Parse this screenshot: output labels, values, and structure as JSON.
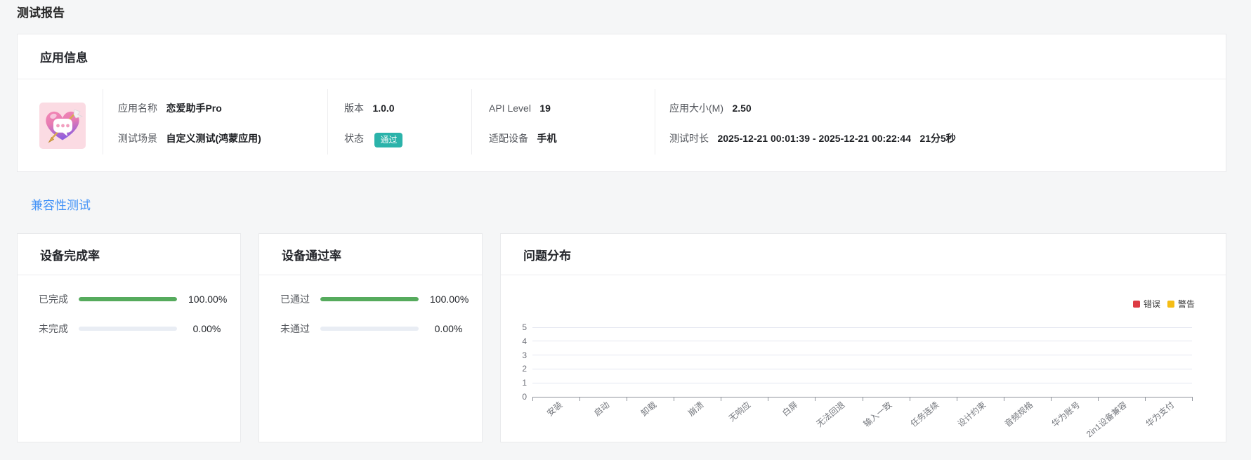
{
  "page": {
    "title": "测试报告",
    "background": "#f5f6f7"
  },
  "app_info": {
    "title": "应用信息",
    "icon": "heart-chat-arrow-app-icon",
    "fields": {
      "app_name": {
        "label": "应用名称",
        "value": "恋爱助手Pro"
      },
      "test_scene": {
        "label": "测试场景",
        "value": "自定义测试(鸿蒙应用)"
      },
      "version": {
        "label": "版本",
        "value": "1.0.0"
      },
      "status": {
        "label": "状态",
        "value": "通过",
        "badge_color": "#2bb3aa"
      },
      "api_level": {
        "label": "API Level",
        "value": "19"
      },
      "device": {
        "label": "适配设备",
        "value": "手机"
      },
      "app_size": {
        "label": "应用大小(M)",
        "value": "2.50"
      },
      "duration": {
        "label": "测试时长",
        "value": "2025-12-21 00:01:39 - 2025-12-21 00:22:44",
        "elapsed": "21分5秒"
      }
    }
  },
  "section_link": {
    "label": "兼容性测试",
    "color": "#4292f7"
  },
  "completion_card": {
    "title": "设备完成率",
    "rows": [
      {
        "label": "已完成",
        "value": "100.00%",
        "percent": 100,
        "color": "#56ab5d"
      },
      {
        "label": "未完成",
        "value": "0.00%",
        "percent": 0,
        "color": "#56ab5d"
      }
    ]
  },
  "pass_card": {
    "title": "设备通过率",
    "rows": [
      {
        "label": "已通过",
        "value": "100.00%",
        "percent": 100,
        "color": "#56ab5d"
      },
      {
        "label": "未通过",
        "value": "0.00%",
        "percent": 0,
        "color": "#56ab5d"
      }
    ]
  },
  "issue_card": {
    "title": "问题分布"
  },
  "chart_data": {
    "type": "bar",
    "title": "问题分布",
    "categories": [
      "安装",
      "启动",
      "卸载",
      "崩溃",
      "无响应",
      "白屏",
      "无法回退",
      "输入一致",
      "任务连续",
      "设计约束",
      "音频规格",
      "华为账号",
      "2in1设备兼容",
      "华为支付"
    ],
    "series": [
      {
        "name": "错误",
        "color": "#dd3b44",
        "values": [
          0,
          0,
          0,
          0,
          0,
          0,
          0,
          0,
          0,
          0,
          0,
          0,
          0,
          0
        ]
      },
      {
        "name": "警告",
        "color": "#f5bd16",
        "values": [
          0,
          0,
          0,
          0,
          0,
          0,
          0,
          0,
          0,
          0,
          0,
          0,
          0,
          0
        ]
      }
    ],
    "xlabel": "",
    "ylabel": "",
    "ylim": [
      0,
      5
    ],
    "yticks": [
      0,
      1,
      2,
      3,
      4,
      5
    ],
    "grid": true,
    "legend_position": "top-right"
  }
}
